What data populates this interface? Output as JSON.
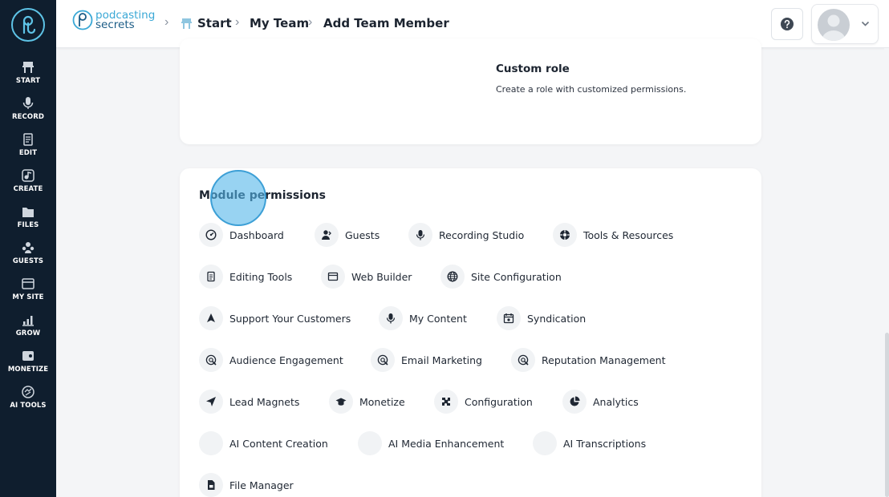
{
  "colors": {
    "sidebar_bg": "#0f1e2e",
    "accent": "#3aa8d6",
    "click_marker": "#54b6e9"
  },
  "brand": {
    "line1": "podcasting",
    "line2": "secrets"
  },
  "sidebar": {
    "items": [
      {
        "label": "START",
        "icon": "start-icon"
      },
      {
        "label": "RECORD",
        "icon": "microphone-icon"
      },
      {
        "label": "EDIT",
        "icon": "edit-icon"
      },
      {
        "label": "CREATE",
        "icon": "create-icon"
      },
      {
        "label": "FILES",
        "icon": "files-icon"
      },
      {
        "label": "GUESTS",
        "icon": "guests-icon"
      },
      {
        "label": "MY SITE",
        "icon": "my-site-icon"
      },
      {
        "label": "GROW",
        "icon": "grow-icon"
      },
      {
        "label": "MONETIZE",
        "icon": "monetize-icon"
      },
      {
        "label": "AI TOOLS",
        "icon": "ai-tools-icon"
      }
    ]
  },
  "breadcrumb": {
    "items": [
      "Start",
      "My Team",
      "Add Team Member"
    ]
  },
  "header": {
    "help_icon": "question-icon",
    "user_menu_icon": "chevron-down-icon"
  },
  "custom_role": {
    "title": "Custom role",
    "description": "Create a role with customized permissions."
  },
  "module_permissions": {
    "title": "Module permissions",
    "rows": [
      [
        {
          "label": "Dashboard",
          "icon": "dashboard-icon"
        },
        {
          "label": "Guests",
          "icon": "guests-icon"
        },
        {
          "label": "Recording Studio",
          "icon": "microphone-icon"
        },
        {
          "label": "Tools & Resources",
          "icon": "tools-icon"
        }
      ],
      [
        {
          "label": "Editing Tools",
          "icon": "edit-icon"
        },
        {
          "label": "Web Builder",
          "icon": "web-builder-icon"
        },
        {
          "label": "Site Configuration",
          "icon": "globe-icon"
        }
      ],
      [
        {
          "label": "Support Your Customers",
          "icon": "support-icon"
        },
        {
          "label": "My Content",
          "icon": "microphone-icon"
        },
        {
          "label": "Syndication",
          "icon": "calendar-icon"
        }
      ],
      [
        {
          "label": "Audience Engagement",
          "icon": "engagement-icon"
        },
        {
          "label": "Email Marketing",
          "icon": "engagement-icon"
        },
        {
          "label": "Reputation Management",
          "icon": "engagement-icon"
        }
      ],
      [
        {
          "label": "Lead Magnets",
          "icon": "send-icon"
        },
        {
          "label": "Monetize",
          "icon": "graduation-cap-icon"
        },
        {
          "label": "Configuration",
          "icon": "puzzle-icon"
        },
        {
          "label": "Analytics",
          "icon": "pie-chart-icon"
        }
      ],
      [
        {
          "label": "AI Content Creation",
          "icon": "blank-icon"
        },
        {
          "label": "AI Media Enhancement",
          "icon": "blank-icon"
        },
        {
          "label": "AI Transcriptions",
          "icon": "blank-icon"
        }
      ],
      [
        {
          "label": "File Manager",
          "icon": "file-manager-icon"
        }
      ]
    ]
  }
}
